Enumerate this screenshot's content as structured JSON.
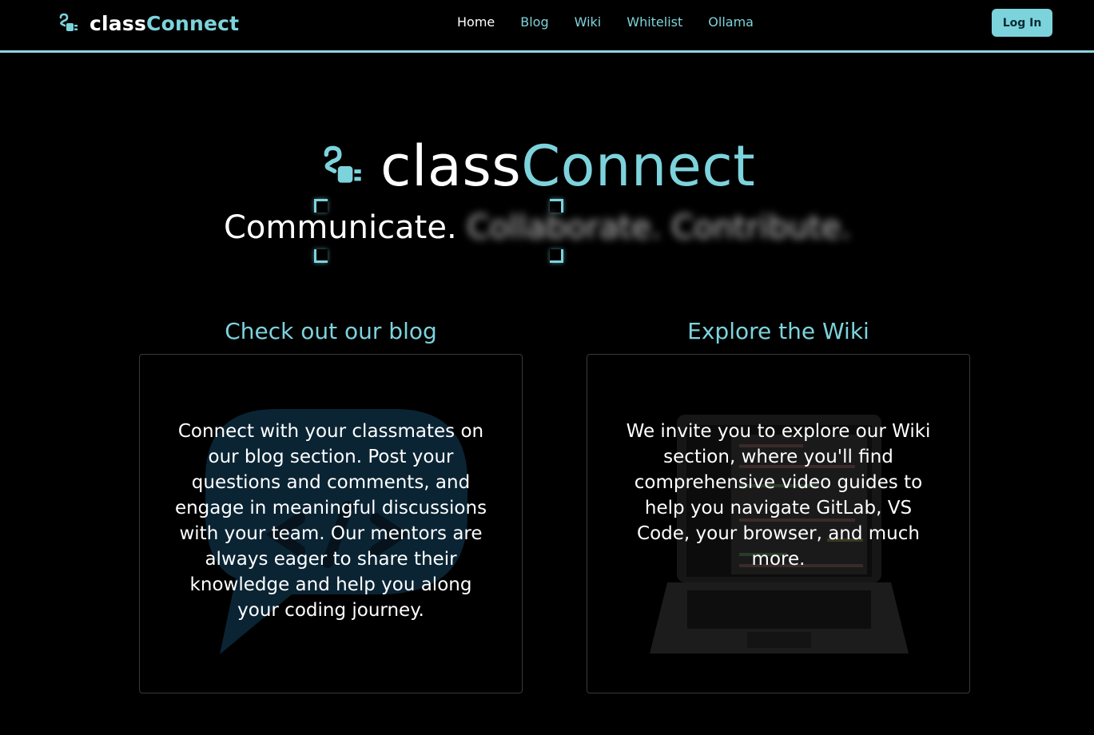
{
  "nav": {
    "brand_part1": "class",
    "brand_part2": "Connect",
    "links": [
      "Home",
      "Blog",
      "Wiki",
      "Whitelist",
      "Ollama"
    ],
    "active_link": "Home",
    "login_label": "Log In"
  },
  "hero": {
    "brand_part1": "class",
    "brand_part2": "Connect",
    "tagline_focused": "Communicate.",
    "tagline_blurred": "Collaborate. Contribute."
  },
  "blog_card": {
    "title": "Check out our blog",
    "text": "Connect with your classmates on our blog section. Post your questions and comments, and engage in meaningful discussions with your team. Our mentors are always eager to share their knowledge and help you along your coding journey."
  },
  "wiki_card": {
    "title": "Explore the Wiki",
    "text": "We invite you to explore our Wiki section, where you'll find comprehensive video guides to help you navigate GitLab, VS Code, your browser, and much more."
  },
  "colors": {
    "accent": "#7dd3dc",
    "background": "#000000",
    "text": "#ffffff"
  },
  "icons": {
    "logo": "plug-icon",
    "blog_background": "chat-bubble-code-icon",
    "wiki_background": "laptop-icon"
  }
}
